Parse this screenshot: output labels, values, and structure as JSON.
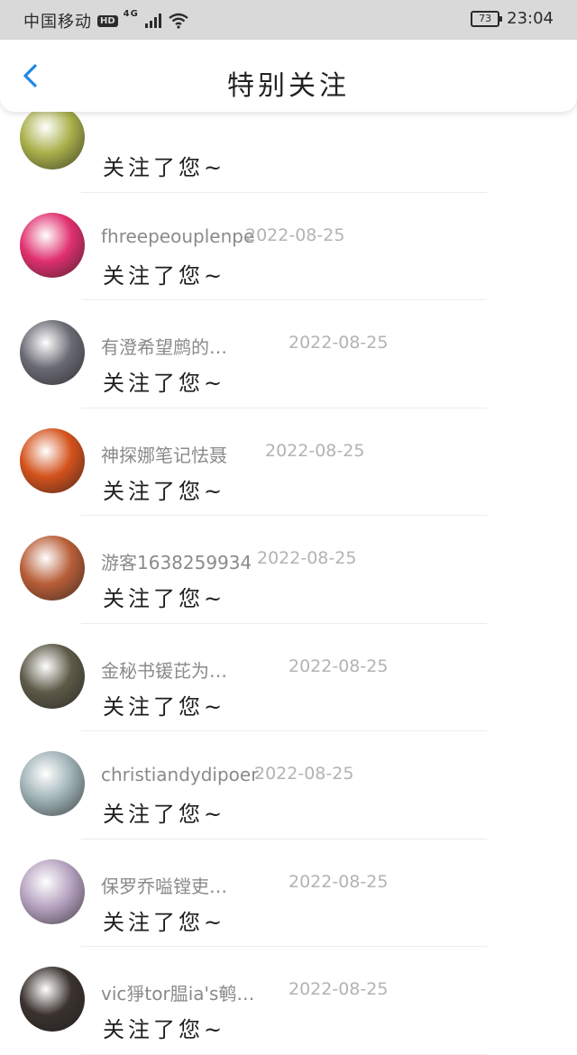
{
  "status_bar": {
    "carrier": "中国移动",
    "hd_badge": "HD",
    "network": "4G",
    "battery": "73",
    "time": "23:04"
  },
  "header": {
    "title": "特别关注"
  },
  "items": [
    {
      "name": "",
      "date": "",
      "message": "关注了您~",
      "avatar_color": "#a9b04a"
    },
    {
      "name": "fhreepeouplenpe",
      "date": "2022-08-25",
      "message": "关注了您~",
      "avatar_color": "#e0306e"
    },
    {
      "name": "有澄希望鹧的…",
      "date": "2022-08-25",
      "message": "关注了您~",
      "avatar_color": "#6a6a74"
    },
    {
      "name": "神探娜笔记怯聂",
      "date": "2022-08-25",
      "message": "关注了您~",
      "avatar_color": "#d4521c"
    },
    {
      "name": "游客1638259934",
      "date": "2022-08-25",
      "message": "关注了您~",
      "avatar_color": "#b85e38"
    },
    {
      "name": "金秘书锾芘为…",
      "date": "2022-08-25",
      "message": "关注了您~",
      "avatar_color": "#5d5a48"
    },
    {
      "name": "christiandydipoer",
      "date": "2022-08-25",
      "message": "关注了您~",
      "avatar_color": "#9fb2b6"
    },
    {
      "name": "保罗乔嗌镗吏…",
      "date": "2022-08-25",
      "message": "关注了您~",
      "avatar_color": "#b6a2c0"
    },
    {
      "name": "vic猙tor腽ia's鹌…",
      "date": "2022-08-25",
      "message": "关注了您~",
      "avatar_color": "#3a322e"
    }
  ]
}
